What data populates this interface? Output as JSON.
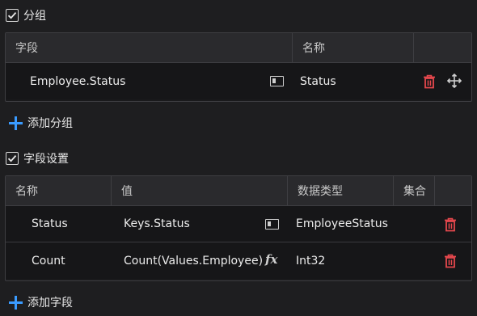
{
  "grouping": {
    "title": "分组",
    "checked": true,
    "columns": [
      "字段",
      "名称"
    ],
    "rows": [
      {
        "field": "Employee.Status",
        "name": "Status"
      }
    ],
    "add_label": "添加分组"
  },
  "fields": {
    "title": "字段设置",
    "checked": true,
    "columns": [
      "名称",
      "值",
      "数据类型",
      "集合"
    ],
    "rows": [
      {
        "name": "Status",
        "value": "Keys.Status",
        "value_icon": "field-tag-icon",
        "type": "EmployeeStatus"
      },
      {
        "name": "Count",
        "value": "Count(Values.Employee)",
        "value_icon": "fx-icon",
        "type": "Int32"
      }
    ],
    "add_label": "添加字段"
  },
  "icons": {
    "fx": "fx"
  },
  "colors": {
    "accent": "#3a9bff",
    "danger": "#e5484d"
  }
}
